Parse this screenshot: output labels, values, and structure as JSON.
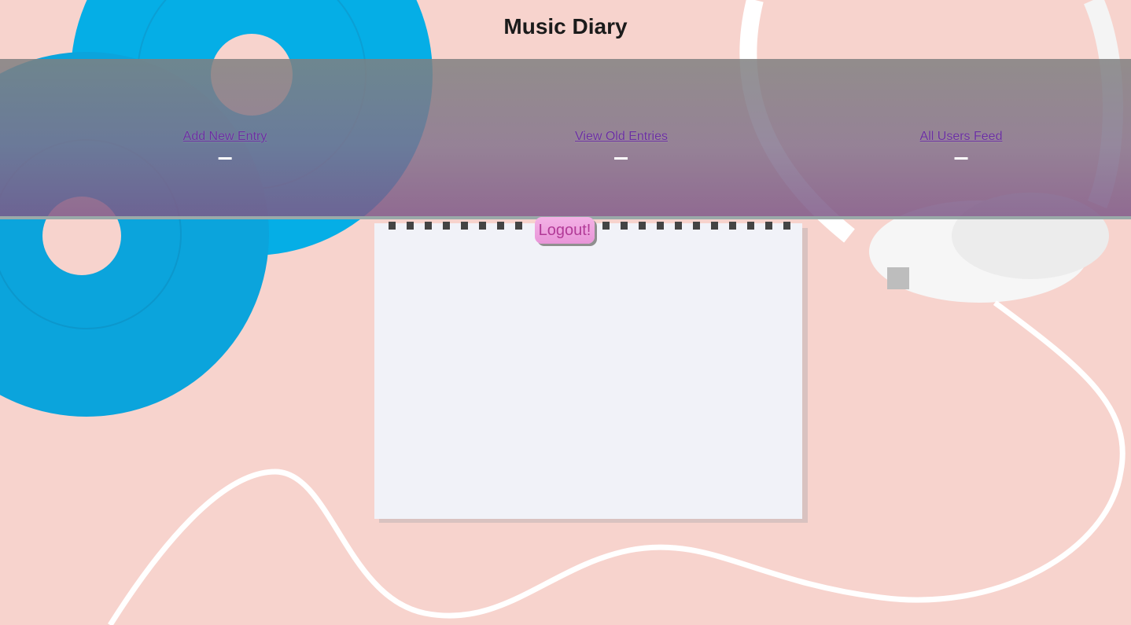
{
  "header": {
    "title": "Music Diary"
  },
  "nav": {
    "items": [
      {
        "label": "Add New Entry"
      },
      {
        "label": "View Old Entries"
      },
      {
        "label": "All Users Feed"
      }
    ]
  },
  "actions": {
    "logout_label": "Logout!"
  },
  "background": {
    "icons": [
      "vinyl-record-icon",
      "notepad-icon",
      "headphones-icon"
    ],
    "colors": {
      "backdrop": "#f7d3cd",
      "vinyl": "#0fa8df",
      "notepad": "#f1f2f8",
      "headphones": "#ffffff",
      "nav_band_top": "#808080",
      "nav_band_bottom": "#7e5887",
      "link": "#6a2fa0",
      "logout_button": "#f4b2e6",
      "logout_text": "#b23a97"
    }
  }
}
